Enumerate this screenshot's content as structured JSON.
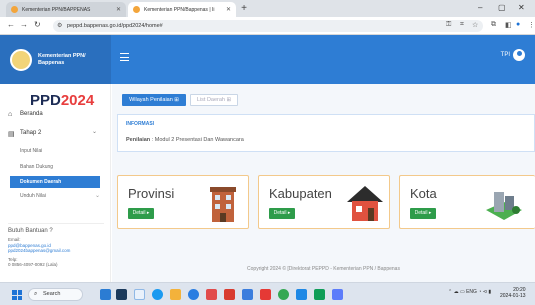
{
  "browser": {
    "tabs": [
      {
        "label": "Kementerian PPN/BAPPENAS",
        "active": false
      },
      {
        "label": "Kementerian PPN/Bappenas | Ii",
        "active": true
      }
    ],
    "url": "peppd.bappenas.go.id/ppd2024/home#",
    "window_controls": {
      "minimize": "–",
      "maximize": "▢",
      "close": "✕"
    }
  },
  "header": {
    "brand_line1": "Kementerian PPN/",
    "brand_line2": "Bappenas",
    "user": "TPI"
  },
  "sidebar": {
    "logo_text": "PPD",
    "logo_year": "2024",
    "items": [
      {
        "label": "Beranda",
        "icon": "home-icon"
      },
      {
        "label": "Tahap 2",
        "icon": "document-icon",
        "chevron": "⌄"
      }
    ],
    "subitems": [
      "Input Nilai",
      "Bahan Dukung",
      "Dokumen Daerah",
      "Unduh Nilai"
    ],
    "active_subitem": "Dokumen Daerah",
    "unduh_chevron": "⌄",
    "help": {
      "title": "Butuh Bantuan ?",
      "email_label": "Email:",
      "email1": "ppd@bappenas.go.id",
      "email2": "ppd2024bappenas@gmail.com",
      "phone_label": "Telp:",
      "phone": "0 0856-4097-0092 (Lala)"
    }
  },
  "main": {
    "btn_wilayah": "Wilayah Penilaian ⊞",
    "btn_list": "List Daerah ⊞",
    "info_title": "INFORMASI",
    "info_label": "Penilaian",
    "info_text": ": Modul 2 Presentasi Dan Wawancara",
    "cards": [
      {
        "title": "Provinsi",
        "button": "Detail ▸"
      },
      {
        "title": "Kabupaten",
        "button": "Detail ▸"
      },
      {
        "title": "Kota",
        "button": "Detail ▸"
      }
    ],
    "footer": "Copyright 2024 © [Direktorat PEPPD - Kementerian PPN / Bappenas"
  },
  "taskbar": {
    "search": "Search",
    "tray_lang": "ENG",
    "tray_lang2": "INTL",
    "time": "20:20",
    "date": "2024-01-13"
  },
  "colors": {
    "primary": "#2e7dd4",
    "success": "#2e9c4a",
    "accent_red": "#e83e3e",
    "card_border": "#f3c98b"
  }
}
